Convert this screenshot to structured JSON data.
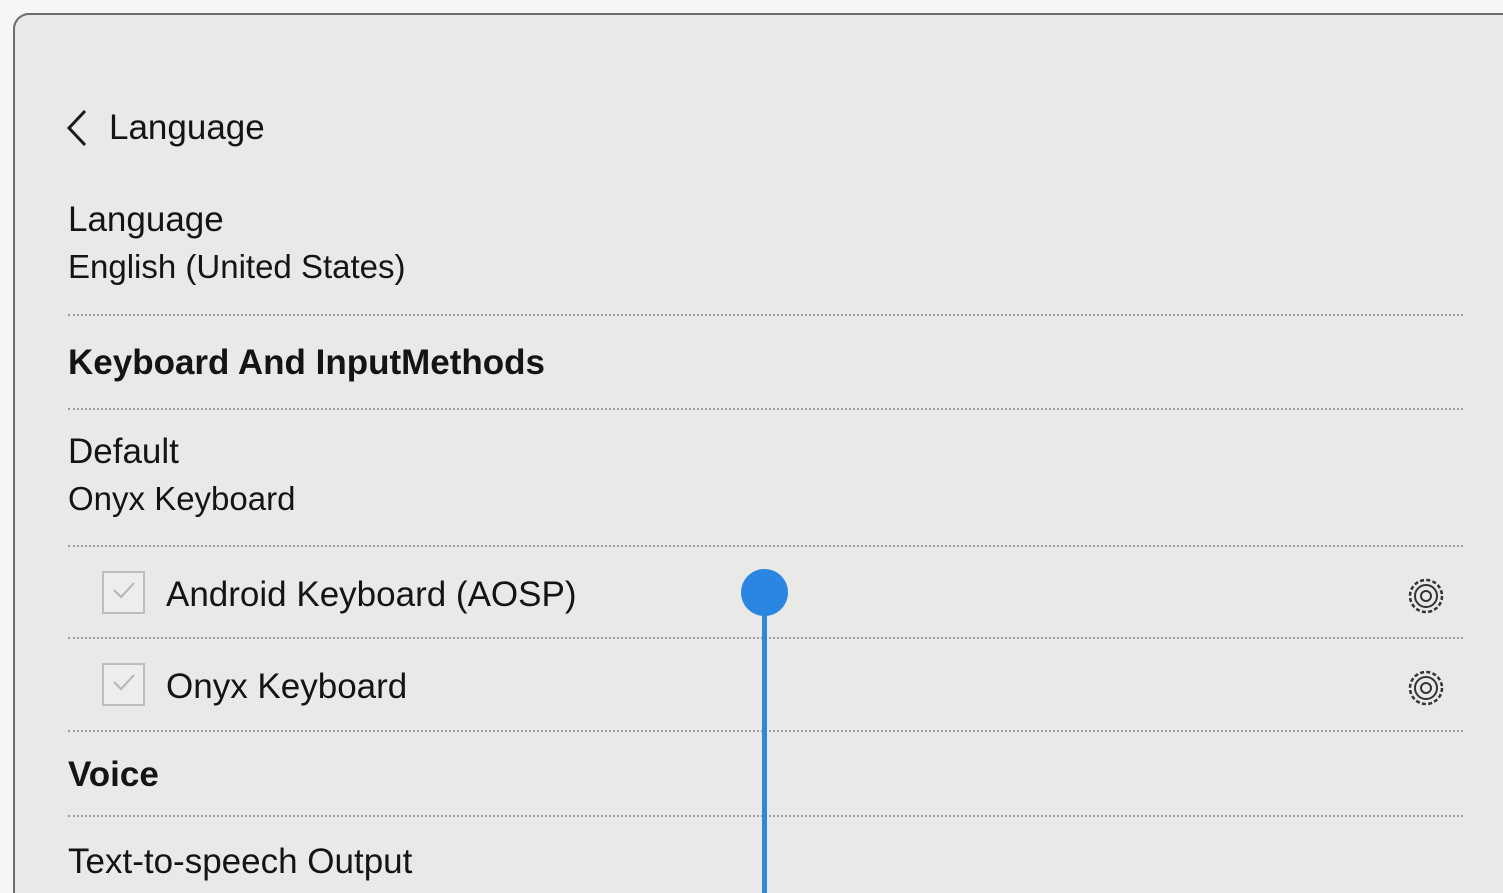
{
  "header": {
    "back_icon": "chevron-left-icon",
    "title": "Language"
  },
  "language": {
    "title": "Language",
    "value": "English (United States)"
  },
  "keyboard_section": {
    "title": "Keyboard And InputMethods"
  },
  "default_keyboard": {
    "title": "Default",
    "value": "Onyx Keyboard"
  },
  "keyboards": [
    {
      "label": "Android Keyboard (AOSP)",
      "checked": true,
      "settings_icon": "gear-icon"
    },
    {
      "label": "Onyx Keyboard",
      "checked": true,
      "settings_icon": "gear-icon"
    }
  ],
  "voice_section": {
    "title": "Voice"
  },
  "tts": {
    "title": "Text-to-speech Output"
  },
  "colors": {
    "touch_indicator": "#2a86e0",
    "background": "#e9e9e7"
  }
}
